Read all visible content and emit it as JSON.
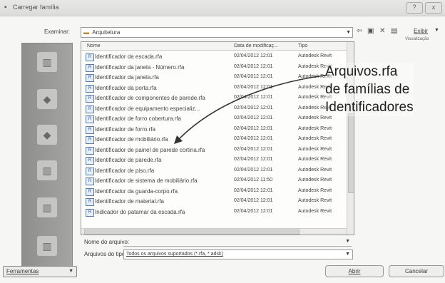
{
  "window": {
    "title": "Carregar família",
    "min_label": "",
    "close_label": "x"
  },
  "toolbar": {
    "look_in_label": "Examinar:",
    "look_in_value": "Arquitetura",
    "views_label": "Exibir",
    "views_caption": "Visualização"
  },
  "columns": {
    "name": "Nome",
    "date": "Data de modificaç...",
    "type": "Tipo"
  },
  "files": [
    {
      "name": "Identificador da escada.rfa",
      "date": "02/04/2012 12:01",
      "type": "Autodesk Revit"
    },
    {
      "name": "Identificador da janela - Número.rfa",
      "date": "02/04/2012 12:01",
      "type": "Autodesk Revit"
    },
    {
      "name": "Identificador da janela.rfa",
      "date": "02/04/2012 12:01",
      "type": "Autodesk Revit"
    },
    {
      "name": "Identificador da porta.rfa",
      "date": "02/04/2012 12:01",
      "type": "Autodesk Revit"
    },
    {
      "name": "Identificador de componentes de parede.rfa",
      "date": "02/04/2012 12:01",
      "type": "Autodesk Revit"
    },
    {
      "name": "Identificador de equipamento especializ...",
      "date": "02/04/2012 12:01",
      "type": "Autodesk Revit"
    },
    {
      "name": "Identificador de forro cobertura.rfa",
      "date": "02/04/2012 12:01",
      "type": "Autodesk Revit"
    },
    {
      "name": "Identificador de forro.rfa",
      "date": "02/04/2012 12:01",
      "type": "Autodesk Revit"
    },
    {
      "name": "Identificador de mobiliário.rfa",
      "date": "02/04/2012 12:01",
      "type": "Autodesk Revit"
    },
    {
      "name": "Identificador de painel de parede cortina.rfa",
      "date": "02/04/2012 12:01",
      "type": "Autodesk Revit"
    },
    {
      "name": "Identificador de parede.rfa",
      "date": "02/04/2012 12:01",
      "type": "Autodesk Revit"
    },
    {
      "name": "Identificador de piso.rfa",
      "date": "02/04/2012 12:01",
      "type": "Autodesk Revit"
    },
    {
      "name": "Identificador de sistema de mobiliário.rfa",
      "date": "02/04/2012 11:50",
      "type": "Autodesk Revit"
    },
    {
      "name": "Identificador da guarda-corpo.rfa",
      "date": "02/04/2012 12:01",
      "type": "Autodesk Revit"
    },
    {
      "name": "Identificador de material.rfa",
      "date": "02/04/2012 12:01",
      "type": "Autodesk Revit"
    },
    {
      "name": "Indicador do patamar da escada.rfa",
      "date": "02/04/2012 12:01",
      "type": "Autodesk Revit"
    }
  ],
  "file_name": {
    "label": "Nome do arquivo:",
    "value": ""
  },
  "file_type": {
    "label": "Arquivos do tipo:",
    "value": "Todos os arquivos suportados (*.rfa, *.adsk)"
  },
  "buttons": {
    "tools": "Ferramentas",
    "open": "Abrir",
    "cancel": "Cancelar"
  },
  "annotation": {
    "line1": "Arquivos.rfa",
    "line2": "de famílias de",
    "line3": "Identificadores"
  }
}
